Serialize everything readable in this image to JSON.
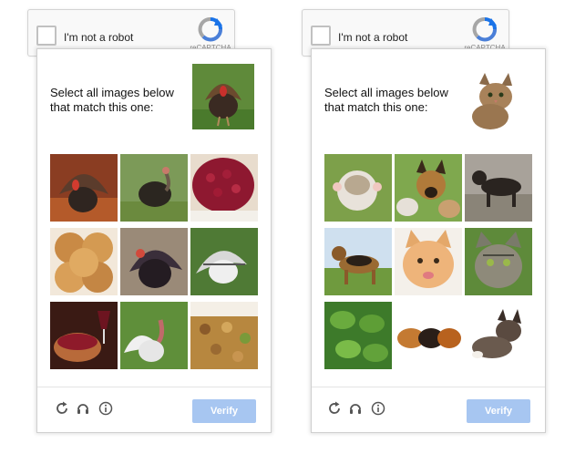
{
  "widgets": [
    {
      "anchor_label": "I'm not a robot",
      "logo_label": "reCAPTCHA",
      "prompt": "Select all images below that match this one:",
      "sample_icon": "turkey-image",
      "tiles": [
        "turkey-image",
        "turkey-image",
        "cranberry-sauce-image",
        "bread-rolls-image",
        "turkey-image",
        "turkey-image",
        "cranberry-wine-image",
        "turkey-image",
        "stuffing-image"
      ],
      "verify_label": "Verify"
    },
    {
      "anchor_label": "I'm not a robot",
      "logo_label": "reCAPTCHA",
      "prompt": "Select all images below that match this one:",
      "sample_icon": "cat-image",
      "tiles": [
        "kitten-image",
        "dog-with-kittens-image",
        "dog-image",
        "dog-image",
        "kitten-image",
        "kitten-image",
        "leaves-image",
        "guinea-pigs-image",
        "kitten-image"
      ],
      "verify_label": "Verify"
    }
  ],
  "colors": {
    "verify_bg": "#a7c6f1",
    "logo_blue": "#1a73e8",
    "logo_gray": "#a6a6a6"
  }
}
